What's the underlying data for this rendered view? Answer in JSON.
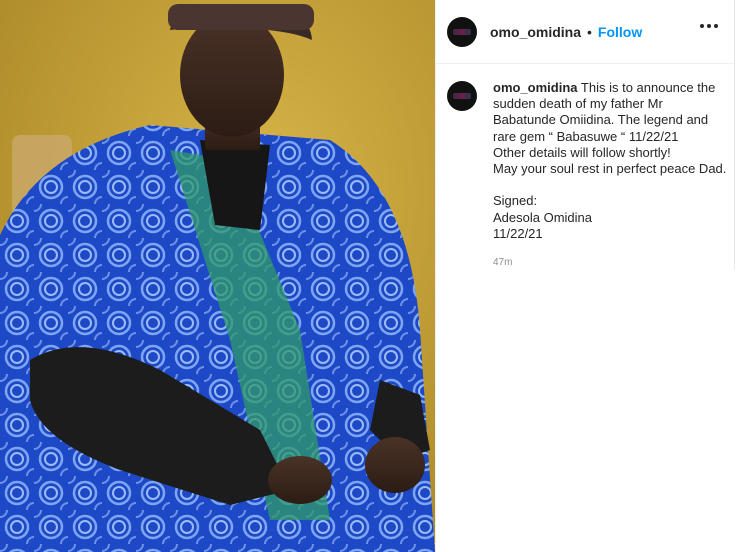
{
  "header": {
    "username": "omo_omidina",
    "separator": "•",
    "follow_label": "Follow",
    "more_icon": "more-horizontal-icon"
  },
  "caption": {
    "username": "omo_omidina",
    "text": "This is to announce the sudden death of my father Mr Babatunde Omiidina. The legend and rare gem “ Babasuwe “ 11/22/21\nOther details will follow shortly!\nMay your soul rest in perfect peace Dad.\n\nSigned:\nAdesola Omidina\n11/22/21",
    "timestamp": "47m"
  },
  "colors": {
    "follow": "#0095f6",
    "text": "#262626",
    "muted": "#8e8e8e",
    "photo_background": "#c8a43a",
    "garment_blue": "#1e4fd0"
  }
}
